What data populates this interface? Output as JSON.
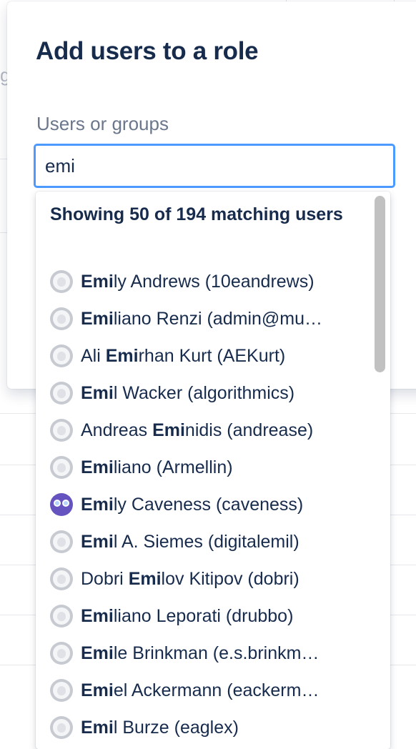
{
  "dialog": {
    "title": "Add users to a role",
    "field_label": "Users or groups",
    "input_value": "emi"
  },
  "results": {
    "heading": "Showing 50 of 194 matching users",
    "users": [
      {
        "pre": "",
        "match": "Emi",
        "post": "ly Andrews (10eandrews)",
        "avatar": "default-avatar-icon"
      },
      {
        "pre": "",
        "match": "Emi",
        "post": "liano Renzi (admin@mu…",
        "avatar": "default-avatar-icon"
      },
      {
        "pre": "Ali ",
        "match": "Emi",
        "post": "rhan Kurt (AEKurt)",
        "avatar": "default-avatar-icon"
      },
      {
        "pre": "",
        "match": "Emi",
        "post": "l Wacker (algorithmics)",
        "avatar": "default-avatar-icon"
      },
      {
        "pre": "Andreas ",
        "match": "Emi",
        "post": "nidis (andrease)",
        "avatar": "default-avatar-icon"
      },
      {
        "pre": "",
        "match": "Emi",
        "post": "liano (Armellin)",
        "avatar": "default-avatar-icon"
      },
      {
        "pre": "",
        "match": "Emi",
        "post": "ly Caveness (caveness)",
        "avatar": "owl-avatar-icon"
      },
      {
        "pre": "",
        "match": "Emi",
        "post": "l A. Siemes (digitalemil)",
        "avatar": "default-avatar-icon"
      },
      {
        "pre": "Dobri ",
        "match": "Emi",
        "post": "lov Kitipov (dobri)",
        "avatar": "default-avatar-icon"
      },
      {
        "pre": "",
        "match": "Emi",
        "post": "liano Leporati (drubbo)",
        "avatar": "default-avatar-icon"
      },
      {
        "pre": "",
        "match": "Emi",
        "post": "le Brinkman (e.s.brinkm…",
        "avatar": "default-avatar-icon"
      },
      {
        "pre": "",
        "match": "Emi",
        "post": "el Ackermann (eackerm…",
        "avatar": "default-avatar-icon"
      },
      {
        "pre": "",
        "match": "Emi",
        "post": "l Burze (eaglex)",
        "avatar": "default-avatar-icon"
      }
    ]
  }
}
